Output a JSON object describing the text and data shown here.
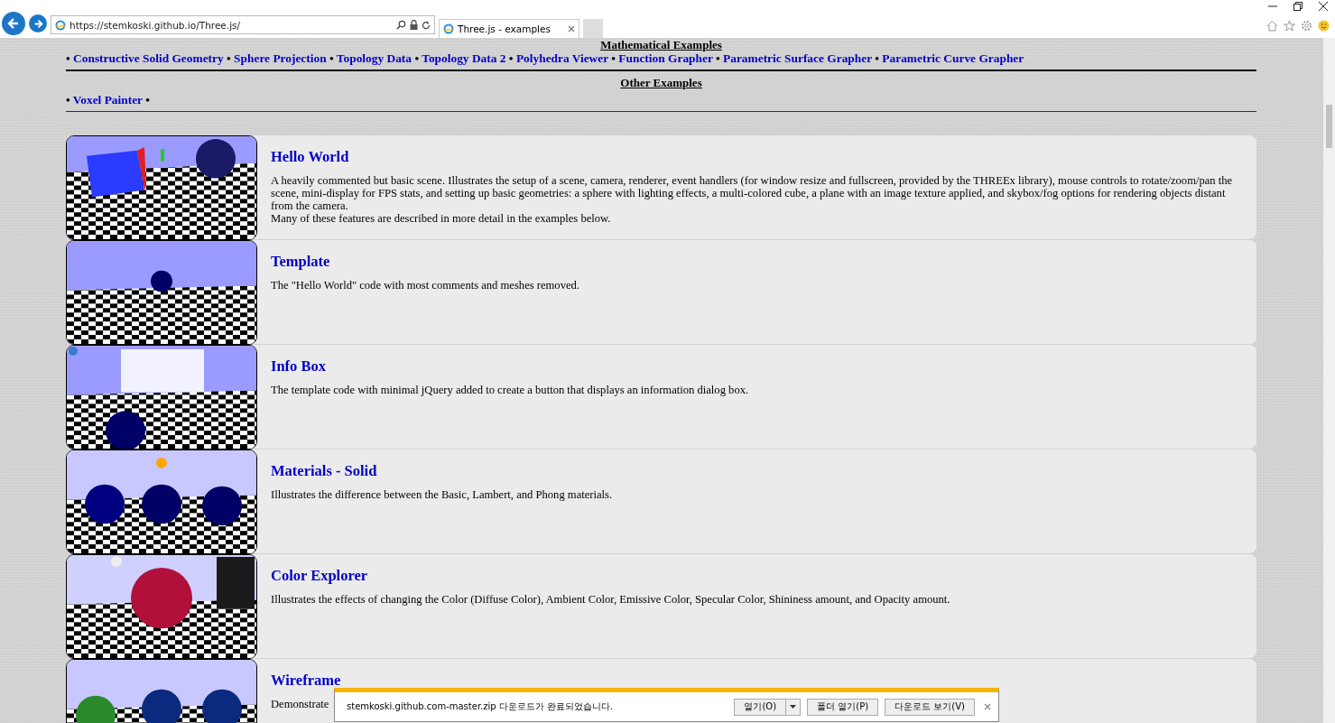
{
  "browser": {
    "address": "https://stemkoski.github.io/Three.js/",
    "tabs": [
      {
        "label": "Three.js - examples",
        "selected": true
      }
    ]
  },
  "separator": "•",
  "math_section": {
    "heading": "Mathematical Examples",
    "links": [
      "Constructive Solid Geometry",
      "Sphere Projection",
      "Topology Data",
      "Topology Data 2",
      "Polyhedra Viewer",
      "Function Grapher",
      "Parametric Surface Grapher",
      "Parametric Curve Grapher"
    ]
  },
  "other_section": {
    "heading": "Other Examples",
    "links": [
      "Voxel Painter"
    ]
  },
  "examples": [
    {
      "title": "Hello World",
      "description": "A heavily commented but basic scene. Illustrates the setup of a scene, camera, renderer, event handlers (for window resize and fullscreen, provided by the THREEx library), mouse controls to rotate/zoom/pan the scene, mini-display for FPS stats, and setting up basic geometries: a sphere with lighting effects, a multi-colored cube, a plane with an image texture applied, and skybox/fog options for rendering objects distant from the camera.\nMany of these features are described in more detail in the examples below."
    },
    {
      "title": "Template",
      "description": "The \"Hello World\" code with most comments and meshes removed."
    },
    {
      "title": "Info Box",
      "description": "The template code with minimal jQuery added to create a button that displays an information dialog box."
    },
    {
      "title": "Materials - Solid",
      "description": "Illustrates the difference between the Basic, Lambert, and Phong materials."
    },
    {
      "title": "Color Explorer",
      "description": "Illustrates the effects of changing the Color (Diffuse Color), Ambient Color, Emissive Color, Specular Color, Shininess amount, and Opacity amount."
    },
    {
      "title": "Wireframe",
      "description": "Demonstrate"
    }
  ],
  "download_bar": {
    "message": "stemkoski.github.com-master.zip 다운로드가 완료되었습니다.",
    "buttons": [
      "열기(O)",
      "폴더 열기(P)",
      "다운로드 보기(V)"
    ]
  }
}
